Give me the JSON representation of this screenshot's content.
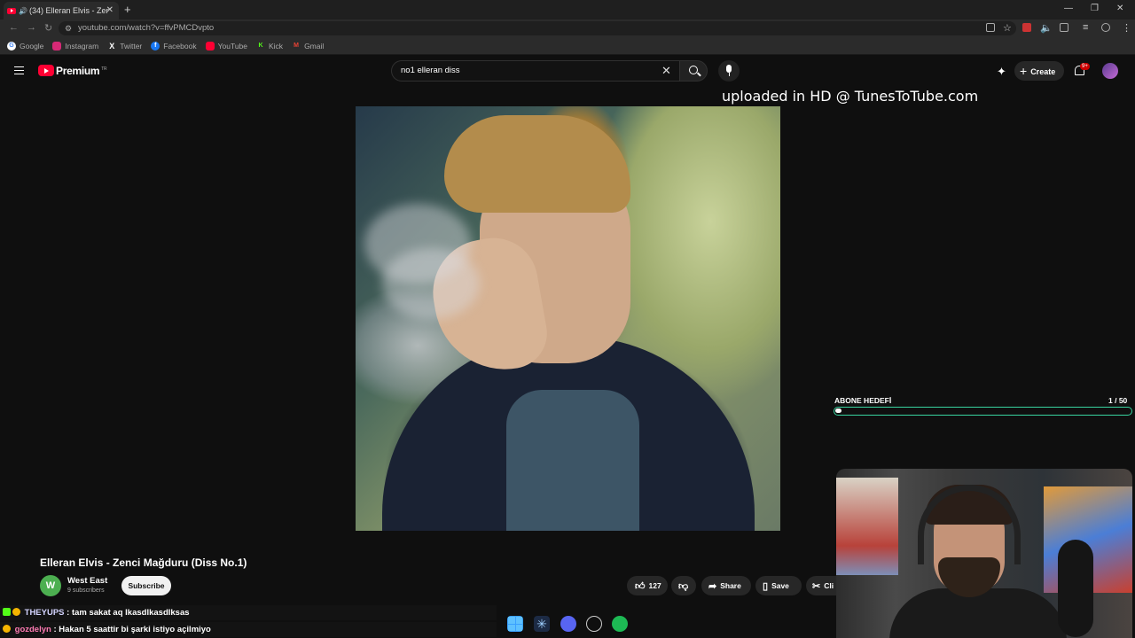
{
  "browser": {
    "tab_title": "(34) Elleran Elvis - Zen",
    "url": "youtube.com/watch?v=ffvPMCDvpto",
    "bookmarks": [
      "Google",
      "Instagram",
      "Twitter",
      "Facebook",
      "YouTube",
      "Kick",
      "Gmail"
    ]
  },
  "youtube": {
    "logo_text": "Premium",
    "region": "TR",
    "search_value": "no1 elleran diss",
    "create_label": "Create",
    "notification_count": "9+"
  },
  "video": {
    "overlay_text": "uploaded in HD @ TunesToTube.com",
    "title": "Elleran Elvis - Zenci Mağduru (Diss No.1)",
    "channel_initial": "W",
    "channel_name": "West East",
    "subscribers": "9 subscribers",
    "subscribe_label": "Subscribe",
    "likes": "127",
    "share_label": "Share",
    "save_label": "Save",
    "clip_label": "Cli"
  },
  "goal": {
    "label": "ABONE HEDEFİ",
    "current": "1",
    "total": "/ 50",
    "fraction": 0.02
  },
  "chat": [
    {
      "user": "THEYUPS",
      "message": ": tam sakat aq lkasdlkasdlksas"
    },
    {
      "user": "gozdelyn",
      "message": ": Hakan 5 saattir bi şarki istiyo açilmiyo"
    }
  ],
  "colors": {
    "yt_red": "#ff0033",
    "goal_border": "#38d39f",
    "kick_green": "#53fc18"
  }
}
